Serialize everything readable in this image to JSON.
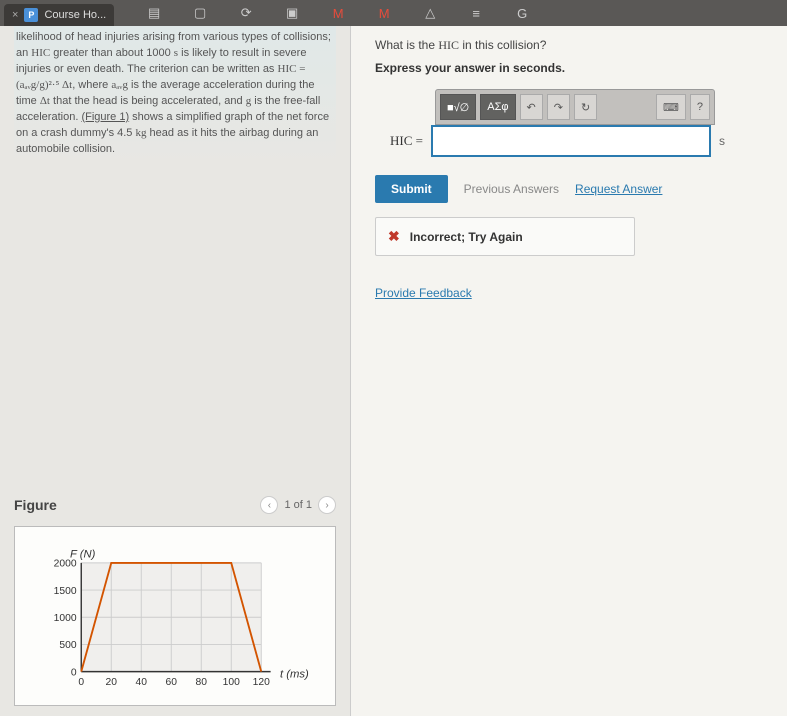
{
  "browser": {
    "tab_title": "Course Ho...",
    "close": "×"
  },
  "problem": {
    "text_part1": "likelihood of head injuries arising from various types of collisions; an ",
    "hic1": "HIC",
    "text_part2": " greater than about 1000 ",
    "unit_s": "s",
    "text_part3": " is likely to result in severe injuries or even death. The criterion can be written as ",
    "formula": "HIC = (aₐᵥg/g)²·⁵ Δt",
    "text_part4": ", where ",
    "aavg": "aₐᵥg",
    "text_part5": " is the average acceleration during the time ",
    "dt": "Δt",
    "text_part6": " that the head is being accelerated, and ",
    "g": "g",
    "text_part7": " is the free-fall acceleration. ",
    "figure_link": "(Figure 1)",
    "text_part8": " shows a simplified graph of the net force on a crash dummy's 4.5 ",
    "kg": "kg",
    "text_part9": " head as it hits the airbag during an automobile collision."
  },
  "figure": {
    "title": "Figure",
    "nav_prev": "‹",
    "page_info": "1 of 1",
    "nav_next": "›",
    "ylabel": "F (N)",
    "xlabel": "t (ms)"
  },
  "chart_data": {
    "type": "line",
    "title": "",
    "xlabel": "t (ms)",
    "ylabel": "F (N)",
    "xlim": [
      0,
      120
    ],
    "ylim": [
      0,
      2000
    ],
    "xticks": [
      0,
      20,
      40,
      60,
      80,
      100,
      120
    ],
    "yticks": [
      0,
      500,
      1000,
      1500,
      2000
    ],
    "x": [
      0,
      20,
      100,
      120
    ],
    "y": [
      0,
      2000,
      2000,
      0
    ]
  },
  "question": {
    "prompt_part1": "What is the ",
    "hic": "HIC",
    "prompt_part2": " in this collision?",
    "instruction": "Express your answer in seconds.",
    "toolbar": {
      "templates": "■√∅",
      "greek": "ΑΣφ",
      "undo": "↶",
      "redo": "↷",
      "reset": "↻",
      "keyboard": "⌨",
      "help": "?"
    },
    "answer_label": "HIC =",
    "answer_value": "",
    "answer_unit": "s",
    "submit": "Submit",
    "previous_answers": "Previous Answers",
    "request_answer": "Request Answer",
    "feedback_icon": "✖",
    "feedback_text": "Incorrect; Try Again",
    "provide_feedback": "Provide Feedback"
  }
}
